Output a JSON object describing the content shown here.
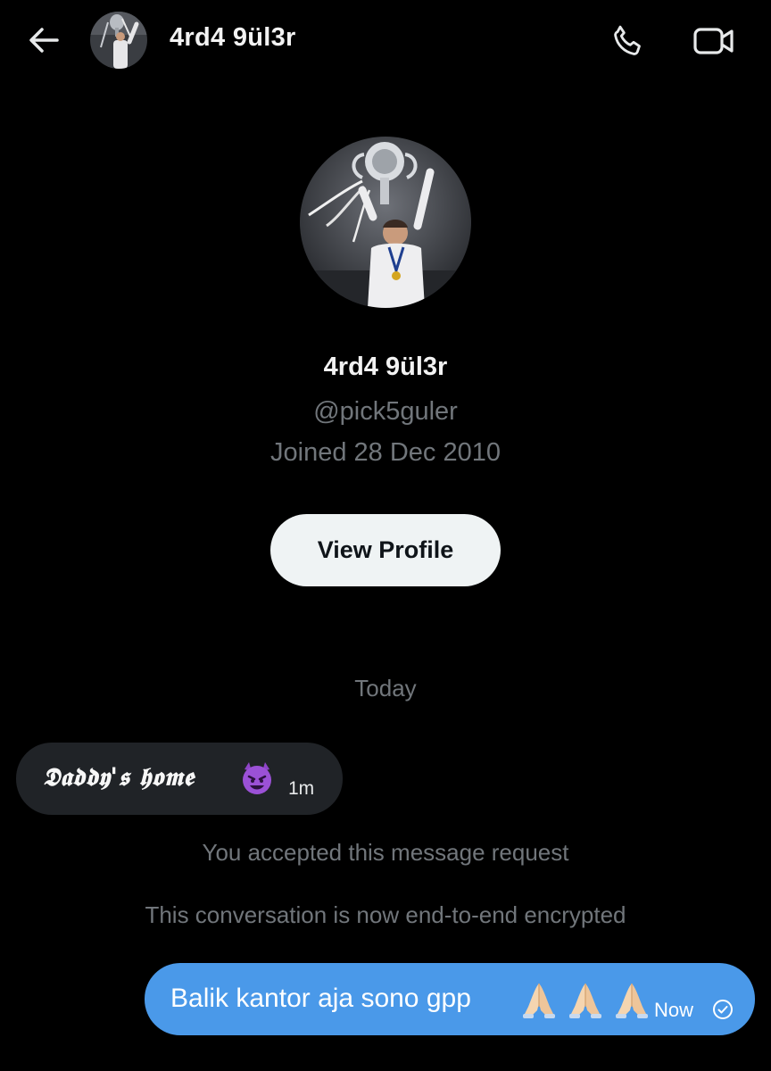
{
  "header": {
    "title": "4rd4 9ül3r"
  },
  "profile": {
    "name": "4rd4 9ül3r",
    "handle": "@pick5guler",
    "joined": "Joined 28 Dec 2010",
    "view_profile_label": "View Profile"
  },
  "conversation": {
    "day_separator": "Today",
    "incoming": {
      "text": "𝕯𝖆𝖉𝖉𝖞'𝖘 𝖍𝖔𝖒𝖊",
      "emoji": "smiling-devil-icon",
      "time": "1m"
    },
    "notices": [
      "You accepted this message request",
      "This conversation is now end-to-end encrypted"
    ],
    "outgoing": {
      "text": "Balik kantor aja sono gpp",
      "emoji": "folded-hands-icon",
      "emoji_count": 3,
      "time": "Now",
      "status": "sent"
    }
  },
  "colors": {
    "background": "#000000",
    "incoming_bubble": "#202327",
    "outgoing_bubble": "#4a99e9",
    "muted_text": "#71767b",
    "button_bg": "#eff3f4"
  }
}
